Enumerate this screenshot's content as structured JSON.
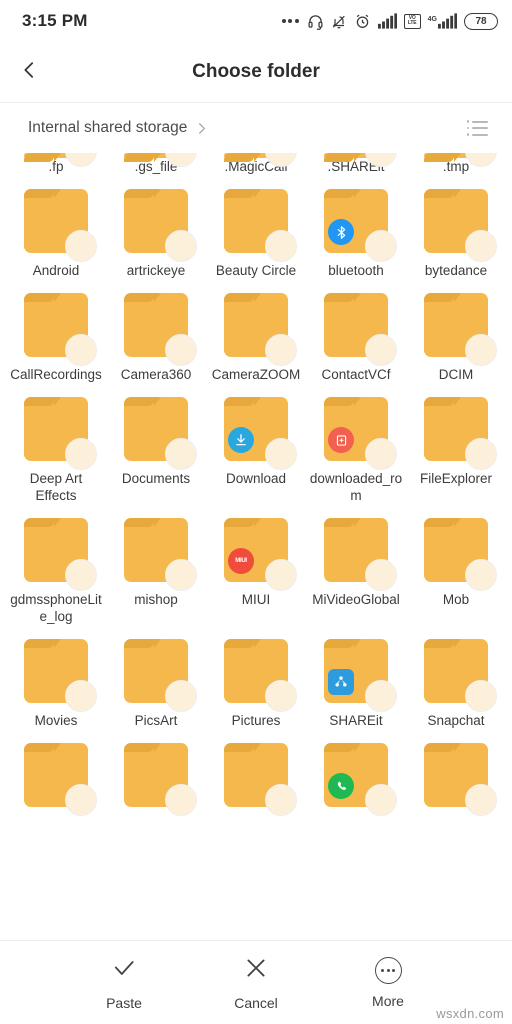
{
  "statusbar": {
    "time": "3:15 PM",
    "battery_level": "78",
    "volte_top": "VO",
    "volte_bottom": "LTE",
    "network_label": "4G",
    "icons": [
      "more-dots-icon",
      "headphones-icon",
      "bell-muted-icon",
      "alarm-clock-icon",
      "signal-bars-icon",
      "volte-icon",
      "signal-bars-4g-icon",
      "battery-icon"
    ]
  },
  "appbar": {
    "title": "Choose folder",
    "back_icon": "chevron-left-icon"
  },
  "breadcrumb": {
    "path": "Internal shared storage",
    "chevron_icon": "chevron-right-icon",
    "view_toggle_icon": "list-view-icon"
  },
  "grid": {
    "rows": [
      {
        "clipped": true,
        "cells": [
          {
            "label": ".fp",
            "badge": null
          },
          {
            "label": ".gs_file",
            "badge": null
          },
          {
            "label": ".MagicCall",
            "badge": null
          },
          {
            "label": ".SHAREit",
            "badge": null
          },
          {
            "label": ".tmp",
            "badge": null
          }
        ]
      },
      {
        "clipped": false,
        "cells": [
          {
            "label": "Android",
            "badge": null
          },
          {
            "label": "artrickeye",
            "badge": null
          },
          {
            "label": "Beauty Circle",
            "badge": null
          },
          {
            "label": "bluetooth",
            "badge": {
              "name": "bluetooth-badge",
              "shape": "round",
              "color": "#2196f3",
              "glyph": "bluetooth"
            }
          },
          {
            "label": "bytedance",
            "badge": null
          }
        ]
      },
      {
        "clipped": false,
        "cells": [
          {
            "label": "CallRecordings",
            "badge": null
          },
          {
            "label": "Camera360",
            "badge": null
          },
          {
            "label": "CameraZOOM",
            "badge": null
          },
          {
            "label": "ContactVCf",
            "badge": null
          },
          {
            "label": "DCIM",
            "badge": null
          }
        ]
      },
      {
        "clipped": false,
        "cells": [
          {
            "label": "Deep Art Effects",
            "badge": null
          },
          {
            "label": "Documents",
            "badge": null
          },
          {
            "label": "Download",
            "badge": {
              "name": "download-badge",
              "shape": "round",
              "color": "#29a8e0",
              "glyph": "download"
            }
          },
          {
            "label": "downloaded_rom",
            "badge": {
              "name": "rom-badge",
              "shape": "round",
              "color": "#f4604f",
              "glyph": "archive"
            }
          },
          {
            "label": "FileExplorer",
            "badge": null
          }
        ]
      },
      {
        "clipped": false,
        "cells": [
          {
            "label": "gdmssphoneLite_log",
            "badge": null
          },
          {
            "label": "mishop",
            "badge": null
          },
          {
            "label": "MIUI",
            "badge": {
              "name": "miui-badge",
              "shape": "round",
              "color": "#f04b3c",
              "glyph": "text",
              "text": "MIUI"
            }
          },
          {
            "label": "MiVideoGlobal",
            "badge": null
          },
          {
            "label": "Mob",
            "badge": null
          }
        ]
      },
      {
        "clipped": false,
        "cells": [
          {
            "label": "Movies",
            "badge": null
          },
          {
            "label": "PicsArt",
            "badge": null
          },
          {
            "label": "Pictures",
            "badge": null
          },
          {
            "label": "SHAREit",
            "badge": {
              "name": "shareit-badge",
              "shape": "rounded",
              "color": "#2e9bdf",
              "glyph": "share"
            }
          },
          {
            "label": "Snapchat",
            "badge": null
          }
        ]
      },
      {
        "clipped": false,
        "cells": [
          {
            "label": "",
            "badge": null
          },
          {
            "label": "",
            "badge": null
          },
          {
            "label": "",
            "badge": null
          },
          {
            "label": "",
            "badge": {
              "name": "whatsapp-badge",
              "shape": "round",
              "color": "#1fb954",
              "glyph": "phone"
            }
          },
          {
            "label": "",
            "badge": null
          }
        ]
      }
    ]
  },
  "bottombar": {
    "actions": [
      {
        "name": "paste-button",
        "label": "Paste",
        "icon": "check-icon"
      },
      {
        "name": "cancel-button",
        "label": "Cancel",
        "icon": "close-icon"
      },
      {
        "name": "more-button",
        "label": "More",
        "icon": "more-circle-icon"
      }
    ]
  },
  "watermark": "wsxdn.com",
  "colors": {
    "folder": "#f5b84c",
    "folder_tab": "#e8a93c",
    "checkbox": "#fdf0db",
    "text": "#3c3c3c"
  }
}
